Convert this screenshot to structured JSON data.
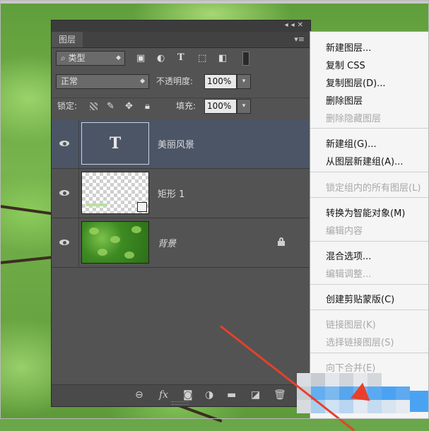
{
  "panel": {
    "tab_label": "图层",
    "filter_label": "类型",
    "blend_mode": "正常",
    "opacity_label": "不透明度:",
    "opacity_value": "100%",
    "lock_label": "锁定:",
    "fill_label": "填充:",
    "fill_value": "100%",
    "layers": [
      {
        "name": "美丽风景",
        "kind": "text",
        "thumb_glyph": "T",
        "selected": true
      },
      {
        "name": "矩形 1",
        "kind": "shape",
        "selected": false
      },
      {
        "name": "背景",
        "kind": "background",
        "locked": true,
        "selected": false
      }
    ],
    "bottom_icons": [
      "link-icon",
      "fx-icon",
      "mask-icon",
      "adjustment-icon",
      "folder-icon",
      "new-layer-icon",
      "trash-icon"
    ],
    "bottom_fx_label": "fx"
  },
  "menu": {
    "items": [
      {
        "label": "新建图层...",
        "disabled": false
      },
      {
        "label": "复制 CSS",
        "disabled": false
      },
      {
        "label": "复制图层(D)...",
        "disabled": false
      },
      {
        "label": "删除图层",
        "disabled": false
      },
      {
        "label": "删除隐藏图层",
        "disabled": true
      },
      {
        "label": "新建组(G)...",
        "disabled": false
      },
      {
        "label": "从图层新建组(A)...",
        "disabled": false
      },
      {
        "label": "锁定组内的所有图层(L)",
        "disabled": true
      },
      {
        "label": "转换为智能对象(M)",
        "disabled": false
      },
      {
        "label": "编辑内容",
        "disabled": true
      },
      {
        "label": "混合选项...",
        "disabled": false
      },
      {
        "label": "编辑调整...",
        "disabled": true
      },
      {
        "label": "创建剪贴蒙版(C)",
        "disabled": false
      },
      {
        "label": "链接图层(K)",
        "disabled": true
      },
      {
        "label": "选择链接图层(S)",
        "disabled": true
      },
      {
        "label": "向下合并(E)",
        "disabled": true
      }
    ]
  },
  "colors": {
    "selected_layer": "#4b5566",
    "panel_bg": "#535353",
    "menu_highlight": "#4aa3f2",
    "annotation_arrow": "#e8402a"
  }
}
